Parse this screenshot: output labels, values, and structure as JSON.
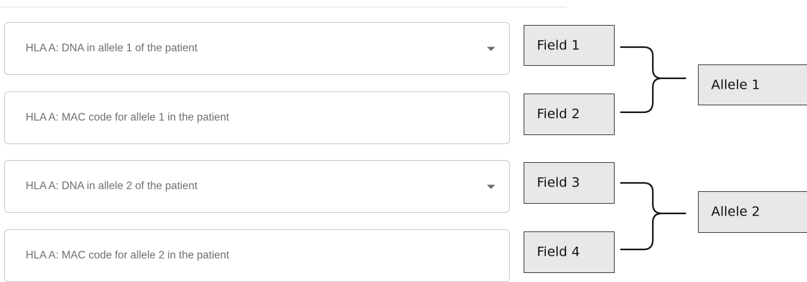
{
  "form": {
    "fields": [
      {
        "placeholder": "HLA A: DNA in allele 1 of the patient",
        "type": "dropdown"
      },
      {
        "placeholder": "HLA A: MAC code for allele 1 in the patient",
        "type": "text"
      },
      {
        "placeholder": "HLA A: DNA in allele 2 of the patient",
        "type": "dropdown"
      },
      {
        "placeholder": "HLA A: MAC code for allele 2 in the patient",
        "type": "text"
      }
    ]
  },
  "annotations": {
    "field_labels": [
      "Field 1",
      "Field 2",
      "Field 3",
      "Field 4"
    ],
    "allele_labels": [
      "Allele 1",
      "Allele 2"
    ],
    "colors": {
      "box_fill": "#e8e8e8",
      "box_border": "#3a3a3a",
      "field_border": "#c8c8c8",
      "placeholder_text": "#6f6f6f"
    }
  },
  "icons": {
    "dropdown_caret": "caret-down-icon",
    "bracket": "curly-brace-icon"
  }
}
